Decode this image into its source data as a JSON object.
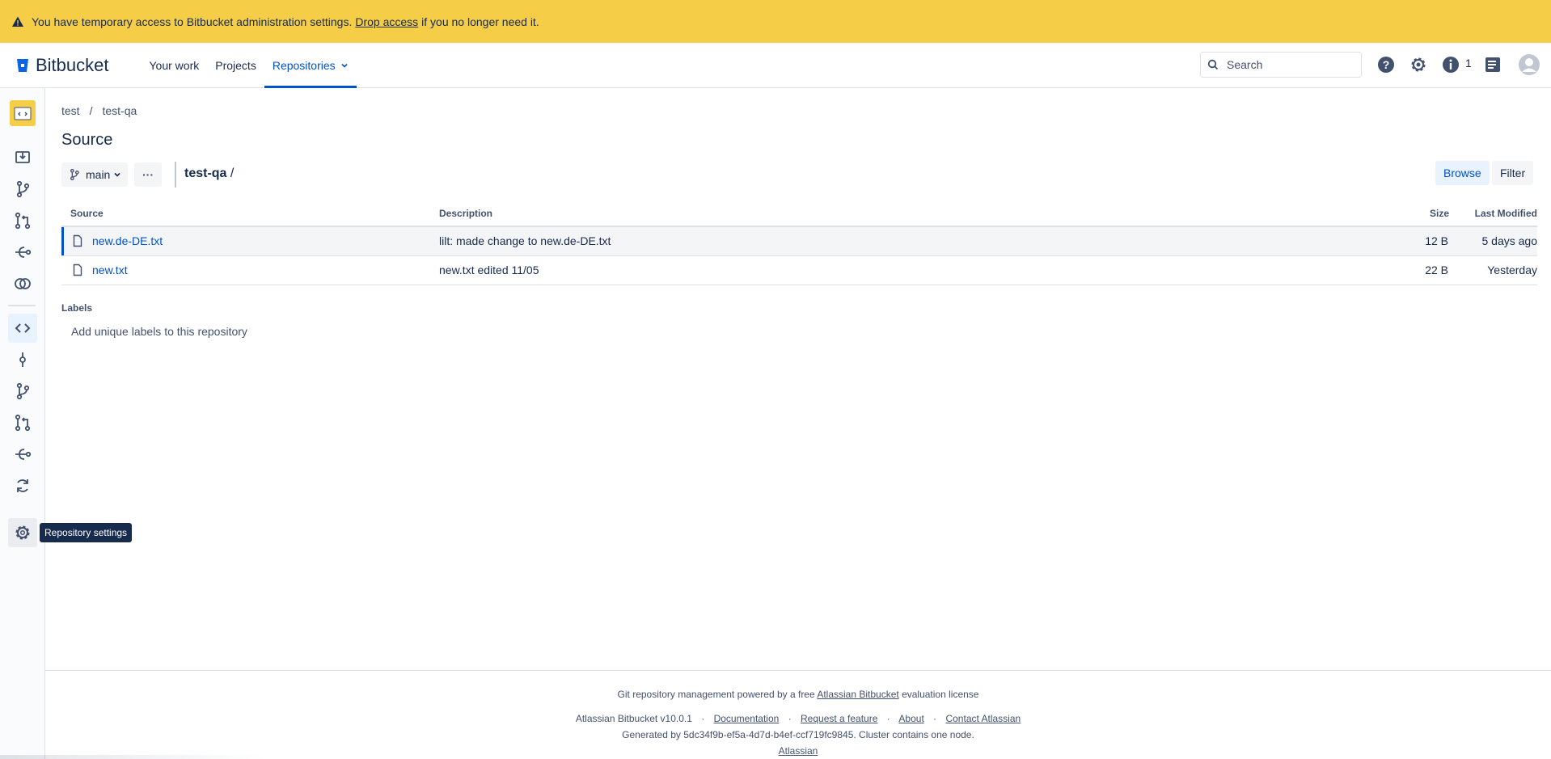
{
  "banner": {
    "text_before": "You have temporary access to Bitbucket administration settings.",
    "link": "Drop access",
    "text_after": "if you no longer need it."
  },
  "header": {
    "product": "Bitbucket",
    "nav": [
      {
        "label": "Your work"
      },
      {
        "label": "Projects"
      },
      {
        "label": "Repositories",
        "active": true
      }
    ],
    "search_placeholder": "Search",
    "notification_count": "1"
  },
  "sidebar": {
    "tooltip": "Repository settings"
  },
  "breadcrumb": {
    "project": "test",
    "separator": "/",
    "repo": "test-qa"
  },
  "page_title": "Source",
  "toolbar": {
    "branch": "main",
    "more": "···",
    "path_repo": "test-qa",
    "path_sep": "/",
    "browse": "Browse",
    "filter": "Filter"
  },
  "table": {
    "headers": {
      "source": "Source",
      "description": "Description",
      "size": "Size",
      "last_modified": "Last Modified"
    },
    "rows": [
      {
        "name": "new.de-DE.txt",
        "description": "lilt: made change to new.de-DE.txt",
        "size": "12 B",
        "modified": "5 days ago"
      },
      {
        "name": "new.txt",
        "description": "new.txt edited 11/05",
        "size": "22 B",
        "modified": "Yesterday"
      }
    ]
  },
  "labels": {
    "heading": "Labels",
    "add": "Add unique labels to this repository"
  },
  "footer": {
    "line1_before": "Git repository management powered by a free",
    "line1_link": "Atlassian Bitbucket",
    "line1_after": "evaluation license",
    "version": "Atlassian Bitbucket v10.0.1",
    "links": [
      "Documentation",
      "Request a feature",
      "About",
      "Contact Atlassian"
    ],
    "generated": "Generated by 5dc34f9b-ef5a-4d7d-b4ef-ccf719fc9845. Cluster contains one node.",
    "atlassian": "Atlassian"
  },
  "colors": {
    "banner": "#f5cd47",
    "accent": "#0052cc",
    "text": "#172b4d"
  }
}
